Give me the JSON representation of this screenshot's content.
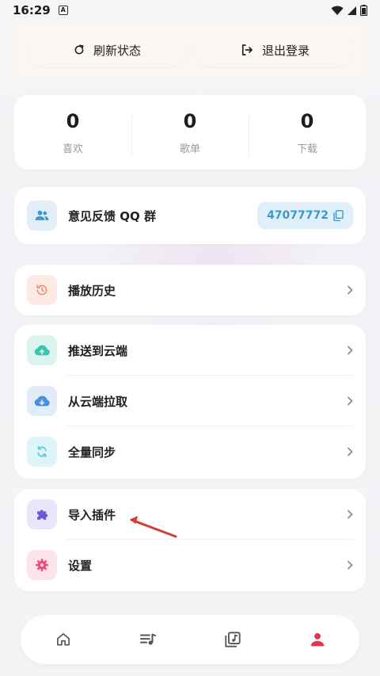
{
  "status_bar": {
    "time": "16:29",
    "notification_badge": "A"
  },
  "account": {
    "refresh_label": "刷新状态",
    "logout_label": "退出登录"
  },
  "stats": [
    {
      "value": "0",
      "label": "喜欢"
    },
    {
      "value": "0",
      "label": "歌单"
    },
    {
      "value": "0",
      "label": "下载"
    }
  ],
  "feedback": {
    "title": "意见反馈 QQ 群",
    "group_number": "47077772"
  },
  "history": {
    "label": "播放历史"
  },
  "cloud": {
    "push_label": "推送到云端",
    "pull_label": "从云端拉取",
    "sync_label": "全量同步"
  },
  "more": {
    "import_plugin_label": "导入插件",
    "settings_label": "设置"
  },
  "colors": {
    "accent_red": "#e8334e",
    "feedback_blue": "#3d97cf",
    "history_orange": "#f08a74",
    "cloud_teal": "#3cc4b3",
    "pull_blue": "#4a90d9",
    "sync_teal": "#5cc9d6",
    "plugin_purple": "#6b5bd8",
    "settings_pink": "#ef4a7c"
  },
  "bottom_nav": [
    {
      "icon": "home-icon",
      "active": false
    },
    {
      "icon": "playlist-icon",
      "active": false
    },
    {
      "icon": "music-library-icon",
      "active": false
    },
    {
      "icon": "person-icon",
      "active": true
    }
  ]
}
